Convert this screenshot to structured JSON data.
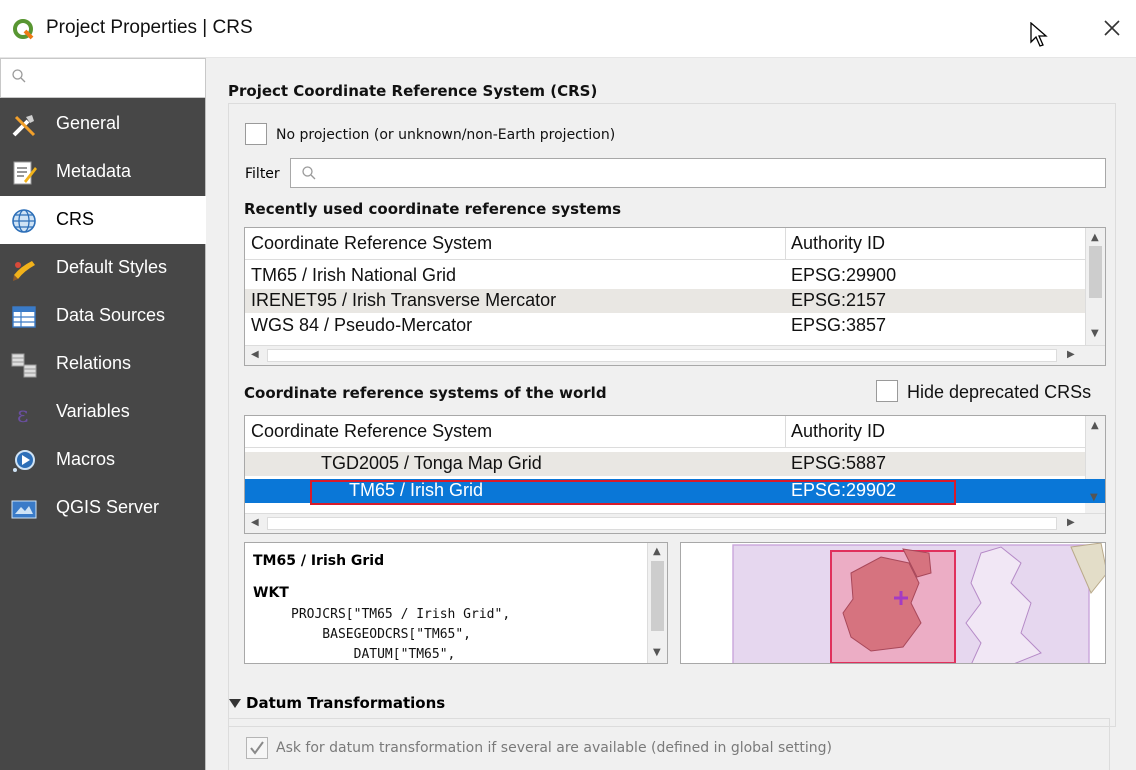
{
  "window": {
    "title": "Project Properties | CRS"
  },
  "sidebar": {
    "items": [
      {
        "label": "General",
        "icon": "tools-icon"
      },
      {
        "label": "Metadata",
        "icon": "metadata-icon"
      },
      {
        "label": "CRS",
        "icon": "globe-icon"
      },
      {
        "label": "Default Styles",
        "icon": "styles-icon"
      },
      {
        "label": "Data Sources",
        "icon": "data-sources-icon"
      },
      {
        "label": "Relations",
        "icon": "relations-icon"
      },
      {
        "label": "Variables",
        "icon": "variables-icon"
      },
      {
        "label": "Macros",
        "icon": "macros-icon"
      },
      {
        "label": "QGIS Server",
        "icon": "qgis-server-icon"
      }
    ],
    "active": "CRS"
  },
  "crs": {
    "section_title": "Project Coordinate Reference System (CRS)",
    "no_projection_label": "No projection (or unknown/non-Earth projection)",
    "filter_label": "Filter",
    "filter_value": "",
    "recent_title": "Recently used coordinate reference systems",
    "col_crs": "Coordinate Reference System",
    "col_auth": "Authority ID",
    "recent_rows": [
      {
        "name": "TM65 / Irish National Grid",
        "auth": "EPSG:29900"
      },
      {
        "name": "IRENET95 / Irish Transverse Mercator",
        "auth": "EPSG:2157"
      },
      {
        "name": "WGS 84 / Pseudo-Mercator",
        "auth": "EPSG:3857"
      }
    ],
    "world_title": "Coordinate reference systems of the world",
    "hide_deprecated_label": "Hide deprecated CRSs",
    "world_rows": [
      {
        "name": "TGD2005 / Tonga Map Grid",
        "auth": "EPSG:5887"
      },
      {
        "name": "TM65 / Irish Grid",
        "auth": "EPSG:29902"
      }
    ],
    "selected": {
      "name": "TM65 / Irish Grid",
      "wkt_label": "WKT",
      "wkt_lines": [
        "PROJCRS[\"TM65 / Irish Grid\",",
        "    BASEGEODCRS[\"TM65\",",
        "        DATUM[\"TM65\","
      ]
    }
  },
  "datum": {
    "title": "Datum Transformations",
    "ask_label": "Ask for datum transformation if several are available (defined in global setting)",
    "ask_checked": true
  },
  "colors": {
    "sidebar_bg": "#474747",
    "selection": "#0a77d7",
    "highlight_outline": "#d81b2a",
    "map_extent": "#e05a7a",
    "map_world": "#d9c6e9"
  }
}
